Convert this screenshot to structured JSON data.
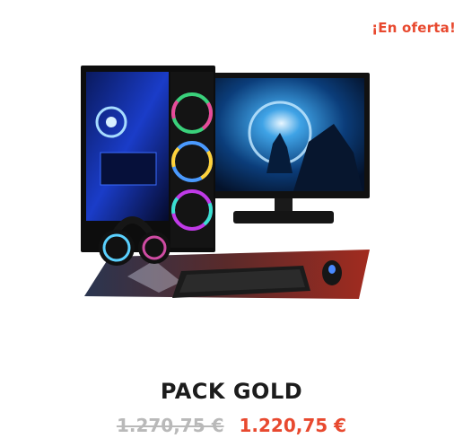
{
  "badge": {
    "label": "¡En oferta!"
  },
  "product": {
    "image_icon": "gaming-pc-bundle-image",
    "title": "PACK GOLD",
    "old_price": "1.270,75 €",
    "new_price": "1.220,75 €"
  },
  "colors": {
    "accent": "#e8492f",
    "strikethrough_gray": "#b9b9b9",
    "title": "#1c1c1c"
  }
}
